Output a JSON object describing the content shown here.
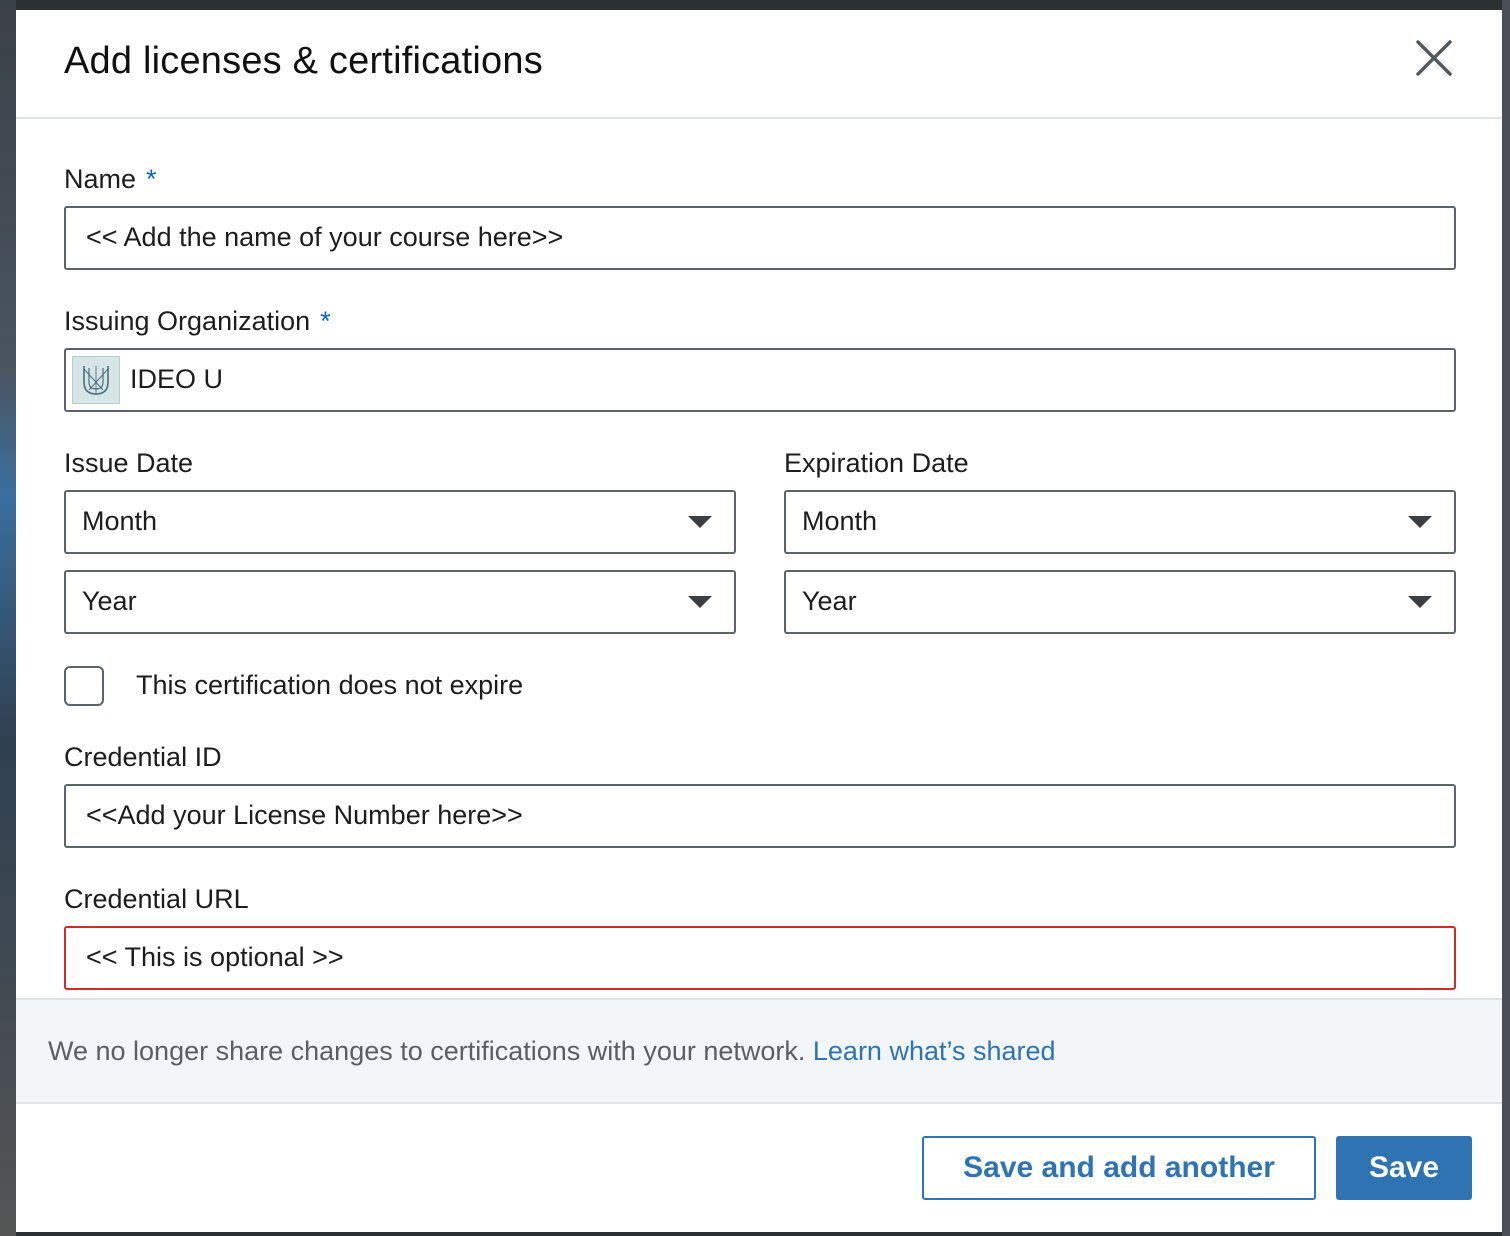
{
  "dialog": {
    "title": "Add licenses & certifications"
  },
  "form": {
    "name": {
      "label": "Name",
      "required_mark": "*",
      "value": "<< Add the name of your course here>>"
    },
    "issuing_org": {
      "label": "Issuing Organization",
      "required_mark": "*",
      "value": "IDEO U",
      "logo_icon": "ideo-u-logo-icon"
    },
    "issue_date": {
      "label": "Issue Date",
      "month": "Month",
      "year": "Year"
    },
    "expiration_date": {
      "label": "Expiration Date",
      "month": "Month",
      "year": "Year"
    },
    "no_expire": {
      "label": "This certification does not expire",
      "checked": false
    },
    "credential_id": {
      "label": "Credential ID",
      "value": "<<Add your License Number here>>"
    },
    "credential_url": {
      "label": "Credential URL",
      "value": "<< This is optional >>",
      "error_color": "#cf2b2b"
    }
  },
  "notice": {
    "text": "We no longer share changes to certifications with your network. ",
    "link": "Learn what’s shared"
  },
  "footer": {
    "secondary_label": "Save and add another",
    "primary_label": "Save"
  },
  "colors": {
    "accent": "#2f73b3",
    "required": "#0a66c2"
  }
}
